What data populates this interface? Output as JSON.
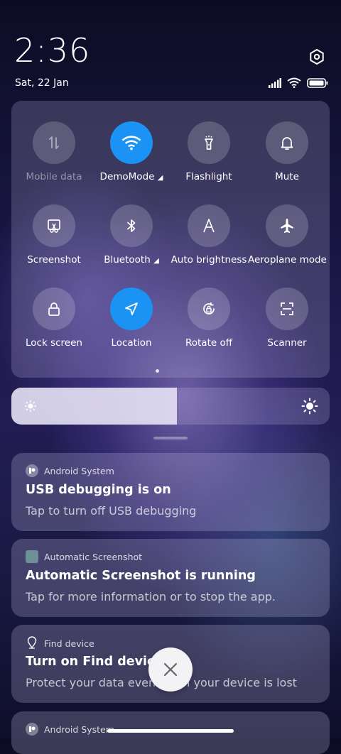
{
  "status": {
    "time": "2:36",
    "date": "Sat, 22 Jan",
    "icons": [
      "signal-icon",
      "wifi-icon",
      "battery-icon"
    ]
  },
  "quick_settings": {
    "tiles": [
      {
        "label": "Mobile data",
        "icon": "mobile-data-icon",
        "state": "unavailable"
      },
      {
        "label": "DemoMode",
        "icon": "wifi-icon",
        "state": "on"
      },
      {
        "label": "Flashlight",
        "icon": "flashlight-icon",
        "state": "off"
      },
      {
        "label": "Mute",
        "icon": "bell-icon",
        "state": "off"
      },
      {
        "label": "Screenshot",
        "icon": "screenshot-icon",
        "state": "off"
      },
      {
        "label": "Bluetooth",
        "icon": "bluetooth-icon",
        "state": "off"
      },
      {
        "label": "Auto brightness",
        "icon": "auto-brightness-icon",
        "state": "off"
      },
      {
        "label": "Aeroplane mode",
        "icon": "airplane-icon",
        "state": "off"
      },
      {
        "label": "Lock screen",
        "icon": "lock-icon",
        "state": "off"
      },
      {
        "label": "Location",
        "icon": "location-icon",
        "state": "on"
      },
      {
        "label": "Rotate off",
        "icon": "rotate-icon",
        "state": "off"
      },
      {
        "label": "Scanner",
        "icon": "scanner-icon",
        "state": "off"
      }
    ],
    "accent": "#1a93f5"
  },
  "brightness": {
    "level": 0.52
  },
  "notifications": [
    {
      "app": "Android System",
      "title": "USB debugging is on",
      "body": "Tap to turn off USB debugging"
    },
    {
      "app": "Automatic Screenshot",
      "title": "Automatic Screenshot is running",
      "body": "Tap for more information or to stop the app."
    },
    {
      "app": "Find device",
      "title": "Turn on Find device",
      "body": "Protect your data even when your device is lost"
    },
    {
      "app": "Android System",
      "title": "",
      "body": ""
    }
  ]
}
